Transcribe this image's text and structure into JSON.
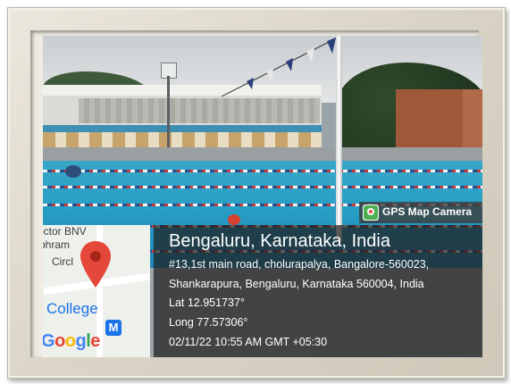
{
  "watermark": {
    "app_name": "GPS Map Camera"
  },
  "location": {
    "title": "Bengaluru, Karnataka, India",
    "address_line1": "#13,1st main road, cholurapalya, Bangalore-560023,",
    "address_line2": "Shankarapura, Bengaluru, Karnataka 560004, India",
    "latitude": "Lat 12.951737°",
    "longitude": "Long 77.57306°",
    "datetime": "02/11/22 10:55 AM GMT +05:30"
  },
  "map_thumbnail": {
    "label_line1": "octor BNV",
    "label_line2": "bhram",
    "label_line3": "Circl",
    "poi_label": "College",
    "logo_text": "Google",
    "transit_badge": "M",
    "pin_color": "#e5483b",
    "poi_color": "#1a73e8"
  },
  "icons": [
    "map-pin-icon",
    "gps-camera-icon",
    "metro-icon"
  ]
}
